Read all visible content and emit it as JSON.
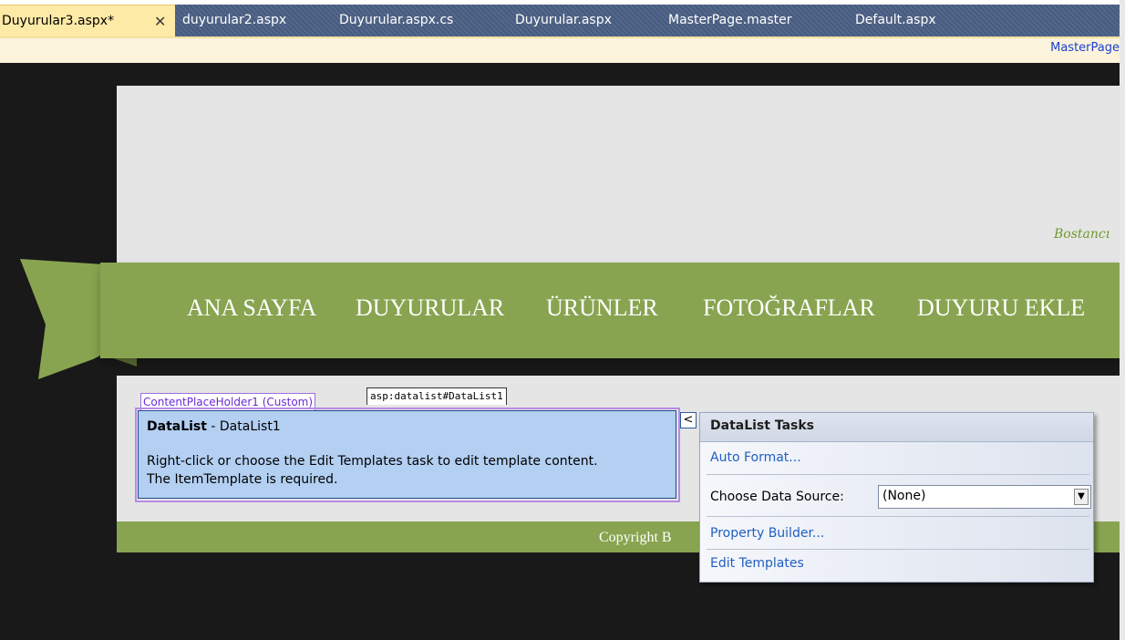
{
  "tabs": [
    {
      "label": "Duyurular3.aspx*",
      "active": true
    },
    {
      "label": "duyurular2.aspx"
    },
    {
      "label": "Duyurular.aspx.cs"
    },
    {
      "label": "Duyurular.aspx"
    },
    {
      "label": "MasterPage.master"
    },
    {
      "label": "Default.aspx"
    }
  ],
  "close_glyph": "✕",
  "masterpage_link": "MasterPage",
  "page": {
    "slogan": "Bostancı",
    "nav": [
      "ANA SAYFA",
      "DUYURULAR",
      "ÜRÜNLER",
      "FOTOĞRAFLAR",
      "DUYURU EKLE"
    ],
    "footer": "Copyright B"
  },
  "designer": {
    "placeholder_tag": "ContentPlaceHolder1 (Custom)",
    "control_tag": "asp:datalist#DataList1",
    "datalist_title_bold": "DataList",
    "datalist_title_rest": " - DataList1",
    "datalist_message_1": "Right-click or choose the Edit Templates task to edit template content.",
    "datalist_message_2": "The ItemTemplate is required.",
    "smart_tag_glyph": "<"
  },
  "tasks": {
    "title": "DataList Tasks",
    "auto_format": "Auto Format...",
    "choose_ds_label": "Choose Data Source:",
    "choose_ds_value": "(None)",
    "property_builder": "Property Builder...",
    "edit_templates": "Edit Templates",
    "dropdown_glyph": "▼"
  },
  "colors": {
    "tab_bar": "#4b6085",
    "active_tab": "#fdeaa6",
    "green": "#88a450",
    "datalist_bg": "#b3cff2",
    "link_blue": "#1f5fc2"
  }
}
